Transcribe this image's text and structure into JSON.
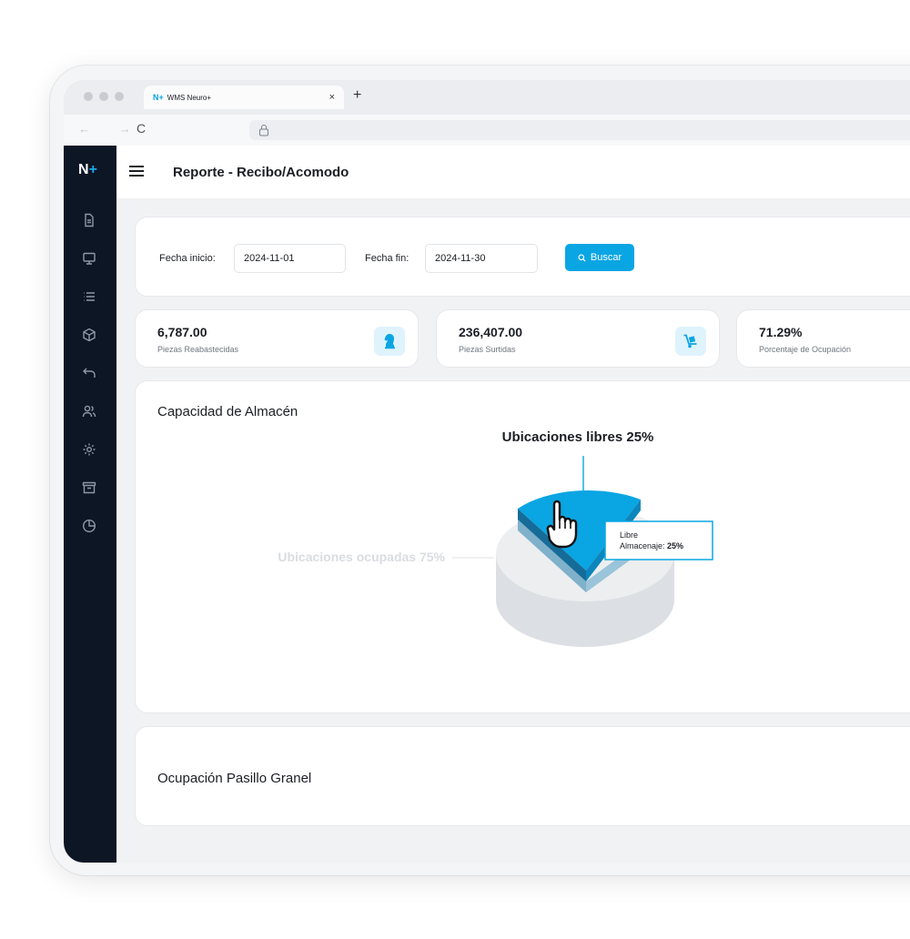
{
  "browser": {
    "tab_logo": "N+",
    "tab_title": "WMS Neuro+",
    "tab_close": "×",
    "new_tab": "+",
    "nav_arrows": "← →",
    "reload": "C"
  },
  "sidebar": {
    "brand": "N",
    "brand_plus": "+",
    "items": [
      {
        "icon": "document-icon"
      },
      {
        "icon": "monitor-icon"
      },
      {
        "icon": "list-icon"
      },
      {
        "icon": "box-icon"
      },
      {
        "icon": "return-icon"
      },
      {
        "icon": "users-icon"
      },
      {
        "icon": "settings-icon"
      },
      {
        "icon": "archive-icon"
      },
      {
        "icon": "pie-chart-icon"
      }
    ]
  },
  "header": {
    "title": "Reporte - Recibo/Acomodo"
  },
  "filters": {
    "start_label": "Fecha inicio:",
    "start_value": "2024-11-01",
    "end_label": "Fecha fin:",
    "end_value": "2024-11-30",
    "search_button": "Buscar"
  },
  "kpis": [
    {
      "value": "6,787.00",
      "label": "Piezas Reabastecidas",
      "icon": "chess-knight-icon"
    },
    {
      "value": "236,407.00",
      "label": "Piezas Surtidas",
      "icon": "hand-truck-icon"
    },
    {
      "value": "71.29%",
      "label": "Porcentaje de Ocupación"
    }
  ],
  "capacity": {
    "title": "Capacidad de Almacén",
    "free_label": "Ubicaciones libres 25%",
    "occupied_label": "Ubicaciones ocupadas 75%",
    "tooltip_line1": "Libre",
    "tooltip_line2_prefix": "Almacenaje: ",
    "tooltip_line2_value": "25%"
  },
  "chart_data": {
    "type": "pie",
    "categories": [
      "Ubicaciones libres",
      "Ubicaciones ocupadas"
    ],
    "values": [
      25,
      75
    ],
    "colors": [
      "#0aa5e3",
      "#eceef0"
    ]
  },
  "ocupacion": {
    "title": "Ocupación Pasillo Granel"
  },
  "colors": {
    "accent": "#0aa5e3",
    "sidebar": "#0d1624"
  }
}
